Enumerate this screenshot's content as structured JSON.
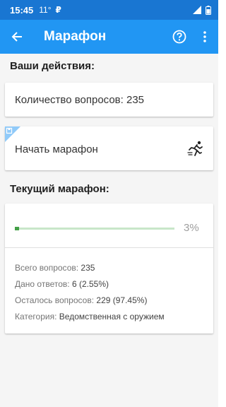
{
  "status_bar": {
    "time": "15:45",
    "temperature": "11°",
    "ruble": "₽"
  },
  "app_bar": {
    "title": "Марафон"
  },
  "actions": {
    "heading": "Ваши действия:",
    "questions_count": "Количество вопросов: 235",
    "start_label": "Начать марафон"
  },
  "current": {
    "heading": "Текущий марафон:",
    "progress_percent_label": "3%",
    "progress_fraction": 0.0255,
    "stats": [
      {
        "label": "Всего вопросов:",
        "value": "235"
      },
      {
        "label": "Дано ответов:",
        "value": "6 (2.55%)"
      },
      {
        "label": "Осталось вопросов:",
        "value": "229 (97.45%)"
      },
      {
        "label": "Категория:",
        "value": "Ведомственная с оружием"
      }
    ]
  },
  "colors": {
    "status_bar": "#1976d2",
    "app_bar": "#2196f3",
    "progress": "#43a047",
    "progress_track": "#c8e6c9"
  }
}
